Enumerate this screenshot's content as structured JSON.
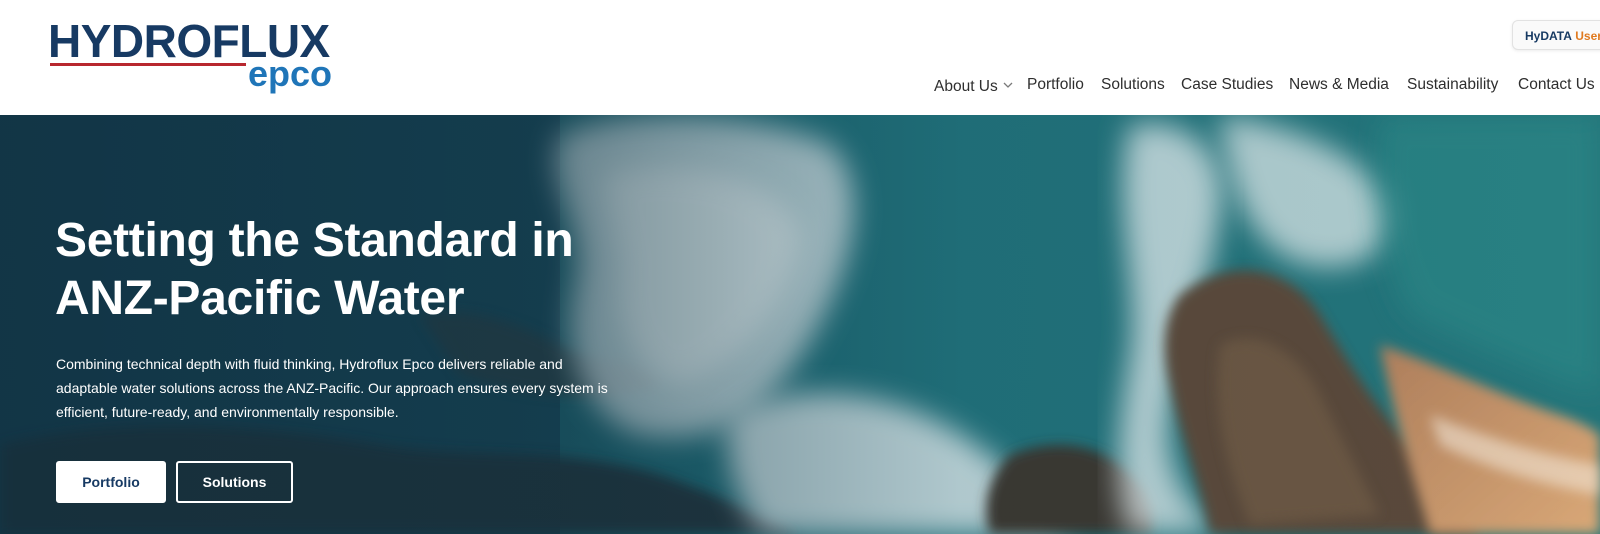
{
  "header": {
    "logo": {
      "main": "HYDROFLUX",
      "sub": "epco"
    },
    "utility": {
      "part1": "HyDATA",
      "part2": "User L"
    },
    "nav": [
      {
        "label": "About Us",
        "has_dropdown": true,
        "icon": "chevron-down-icon"
      },
      {
        "label": "Portfolio"
      },
      {
        "label": "Solutions"
      },
      {
        "label": "Case Studies"
      },
      {
        "label": "News & Media"
      },
      {
        "label": "Sustainability"
      },
      {
        "label": "Contact Us"
      }
    ]
  },
  "hero": {
    "title_line1": "Setting the Standard in",
    "title_line2": "ANZ-Pacific Water",
    "description": "Combining technical depth with fluid thinking, Hydroflux Epco delivers reliable and adaptable water solutions across the ANZ-Pacific. Our approach ensures every system is efficient, future-ready, and environmentally responsible.",
    "buttons": {
      "primary": "Portfolio",
      "secondary": "Solutions"
    },
    "background": "aerial-ocean-coastline-image"
  },
  "colors": {
    "brand_navy": "#173a63",
    "brand_blue": "#1f75b8",
    "brand_red": "#b8282f",
    "accent_orange": "#e07a1f",
    "hero_teal": "#1d5a66"
  }
}
